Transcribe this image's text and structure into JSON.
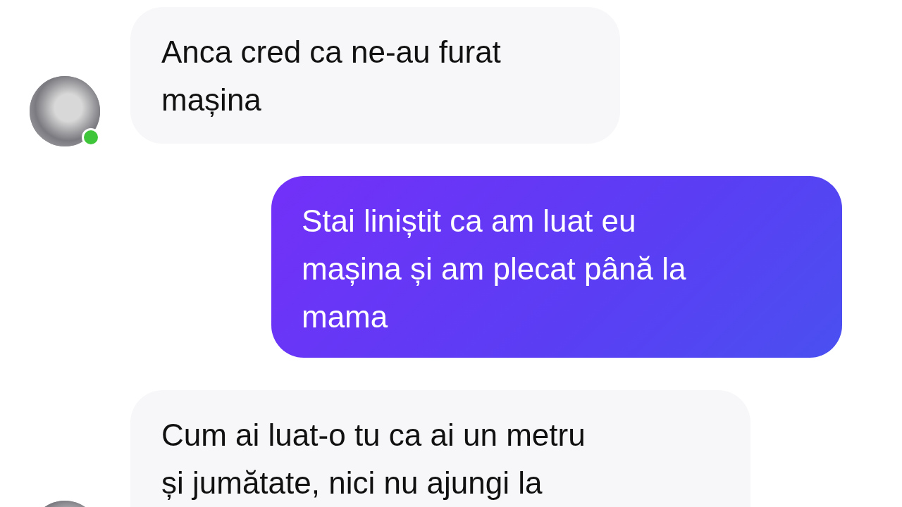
{
  "messages": [
    {
      "kind": "incoming",
      "text": "Anca cred ca ne-au furat\nmașina",
      "avatar": {
        "online": true
      }
    },
    {
      "kind": "outgoing",
      "text": "Stai liniștit ca am luat eu\nmașina și am plecat până la\nmama"
    },
    {
      "kind": "incoming",
      "text": "Cum ai luat-o tu ca ai un metru\nși jumătate, nici nu ajungi la"
    }
  ]
}
